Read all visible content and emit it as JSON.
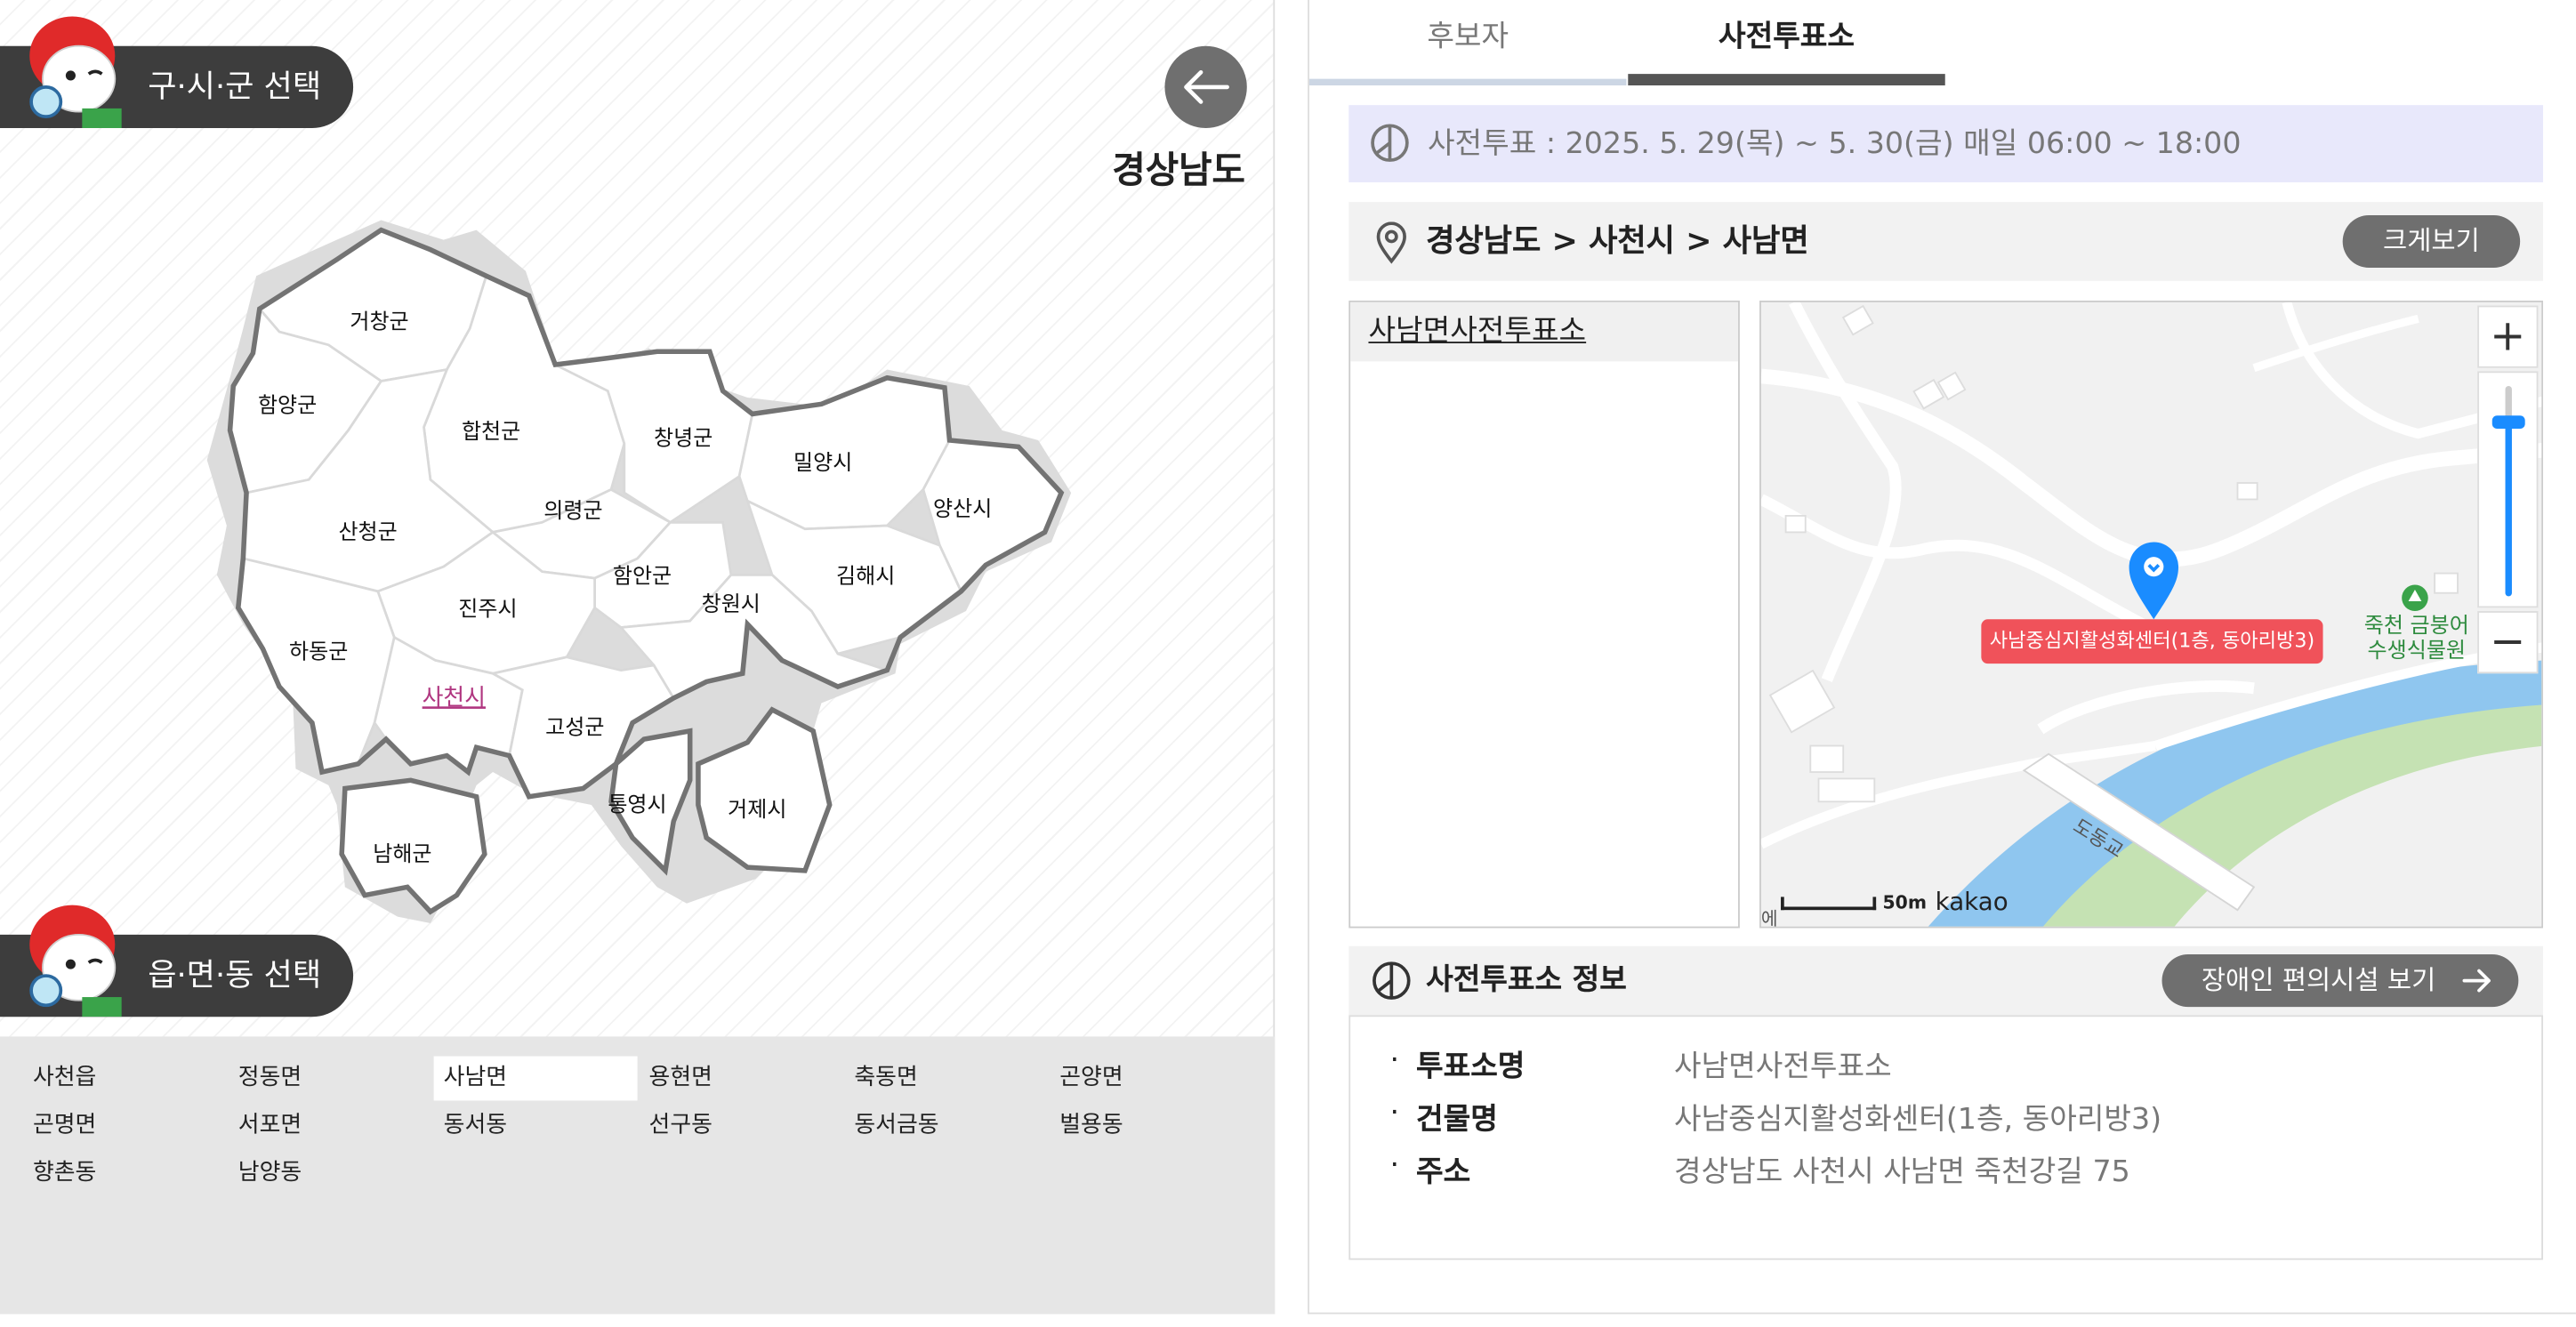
{
  "sido_select": {
    "label": "구·시·군 선택"
  },
  "emd_select": {
    "label": "읍·면·동 선택"
  },
  "region_title": "경상남도",
  "map": {
    "districts": [
      "거창군",
      "함양군",
      "합천군",
      "창녕군",
      "밀양시",
      "양산시",
      "의령군",
      "산청군",
      "함안군",
      "김해시",
      "진주시",
      "창원시",
      "하동군",
      "사천시",
      "고성군",
      "통영시",
      "거제시",
      "남해군"
    ],
    "selected": "사천시",
    "highlight_color": "#b03680"
  },
  "emd_list": {
    "items": [
      "사천읍",
      "정동면",
      "사남면",
      "용현면",
      "축동면",
      "곤양면",
      "곤명면",
      "서포면",
      "동서동",
      "선구동",
      "동서금동",
      "벌용동",
      "향촌동",
      "남양동"
    ],
    "selected": "사남면"
  },
  "tabs": {
    "candidate": "후보자",
    "early_vote": "사전투표소",
    "active": "사전투표소"
  },
  "period": {
    "text": "사전투표 : 2025. 5. 29(목) ~ 5. 30(금) 매일 06:00 ~ 18:00"
  },
  "location": {
    "breadcrumb": "경상남도 > 사천시 > 사남면",
    "enlarge_button": "크게보기"
  },
  "polling_list": {
    "items": [
      "사남면사전투표소"
    ]
  },
  "kakao_map": {
    "marker_label": "사남중심지활성화센터(1층, 동아리방3)",
    "poi_line1": "죽천 금붕어",
    "poi_line2": "수생식물원",
    "road_label": "도동교",
    "scale_label": "50m",
    "brand": "kakao",
    "partial_label": "에",
    "zoom_in": "+",
    "zoom_out": "−"
  },
  "info": {
    "title": "사전투표소 정보",
    "accessibility_button": "장애인 편의시설 보기",
    "rows": [
      {
        "key": "투표소명",
        "value": "사남면사전투표소"
      },
      {
        "key": "건물명",
        "value": "사남중심지활성화센터(1층, 동아리방3)"
      },
      {
        "key": "주소",
        "value": "경상남도 사천시 사남면 죽천강길 75"
      }
    ]
  },
  "colors": {
    "accent_pill": "#3d3d3d",
    "marker_blue": "#1a8cff",
    "marker_label_bg": "#f0525a",
    "period_bg": "#e8e8fb"
  }
}
